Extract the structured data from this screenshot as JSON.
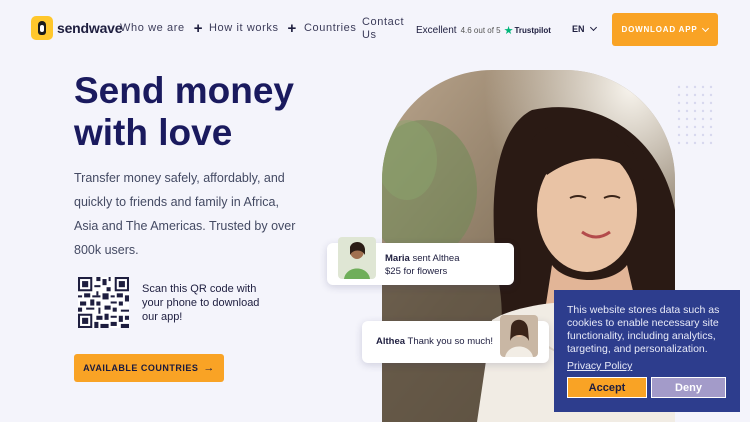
{
  "brand": {
    "name": "sendwave"
  },
  "nav": {
    "items": [
      {
        "label": "Who we are"
      },
      {
        "label": "How it works"
      },
      {
        "label": "Countries"
      },
      {
        "label": "Contact Us"
      }
    ],
    "trustpilot": {
      "rating_word": "Excellent",
      "score": "4.6 out of 5",
      "brand": "Trustpilot"
    },
    "language": "EN",
    "download_label": "DOWNLOAD APP"
  },
  "hero": {
    "title": "Send money with love",
    "subtitle": "Transfer money safely, affordably, and quickly to friends and family in Africa, Asia and The Americas. Trusted by over 800k users.",
    "qr_text": "Scan this QR code with your phone to download our app!",
    "cta_label": "AVAILABLE COUNTRIES",
    "cta_arrow": "→"
  },
  "chat": {
    "first": {
      "sender": "Maria",
      "action": "sent Althea",
      "detail": "$25 for flowers"
    },
    "second": {
      "sender": "Althea",
      "message": "Thank you so much!"
    }
  },
  "cookie": {
    "message": "This website stores data such as cookies to enable necessary site functionality, including analytics, targeting, and personalization.",
    "policy_link": "Privacy Policy",
    "accept_label": "Accept",
    "deny_label": "Deny"
  },
  "colors": {
    "accent": "#f9a325",
    "heading": "#1a1a5e",
    "cookie_bg": "#2d3d8d",
    "trustpilot_star": "#00b67a"
  },
  "icons": [
    "plus-icon",
    "chevron-down-icon",
    "arrow-right-icon",
    "trustpilot-star-icon",
    "qr-code"
  ]
}
